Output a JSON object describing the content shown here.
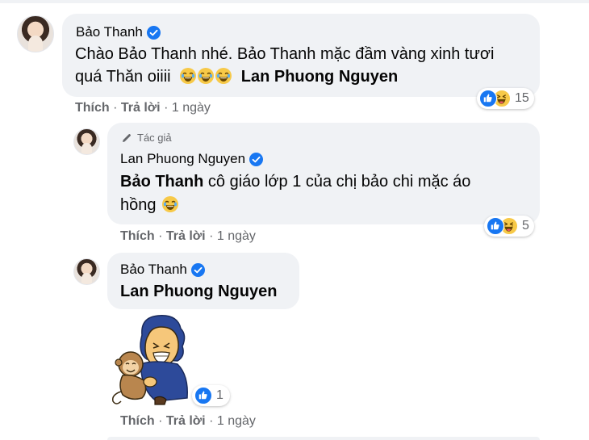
{
  "comments": [
    {
      "author": "Bảo Thanh",
      "text_line1": "Chào Bảo Thanh nhé. Bảo Thanh mặc đầm vàng xinh tươi",
      "text_line2_prefix": "quá Thăn oiiii",
      "mention": "Lan Phuong Nguyen",
      "emoji_count": 3,
      "reaction_count": "15",
      "actions": {
        "like": "Thích",
        "reply": "Trả lời",
        "time": "1 ngày"
      }
    },
    {
      "badge": "Tác giả",
      "author": "Lan Phuong Nguyen",
      "mention": "Bảo Thanh",
      "text_line1_rest": " cô giáo lớp 1 của chị bảo chi mặc áo",
      "text_line2": "hồng",
      "reaction_count": "5",
      "actions": {
        "like": "Thích",
        "reply": "Trả lời",
        "time": "1 ngày"
      }
    },
    {
      "author": "Bảo Thanh",
      "mention": "Lan Phuong Nguyen",
      "sticker": "hugging-man-and-monkey-sticker",
      "reaction_count": "1",
      "actions": {
        "like": "Thích",
        "reply": "Trả lời",
        "time": "1 ngày"
      }
    }
  ],
  "separator": " · ",
  "colors": {
    "bubble": "#f0f2f5",
    "like_blue": "#1877f2",
    "haha_yellow": "#f7c948",
    "meta_gray": "#65676b"
  }
}
